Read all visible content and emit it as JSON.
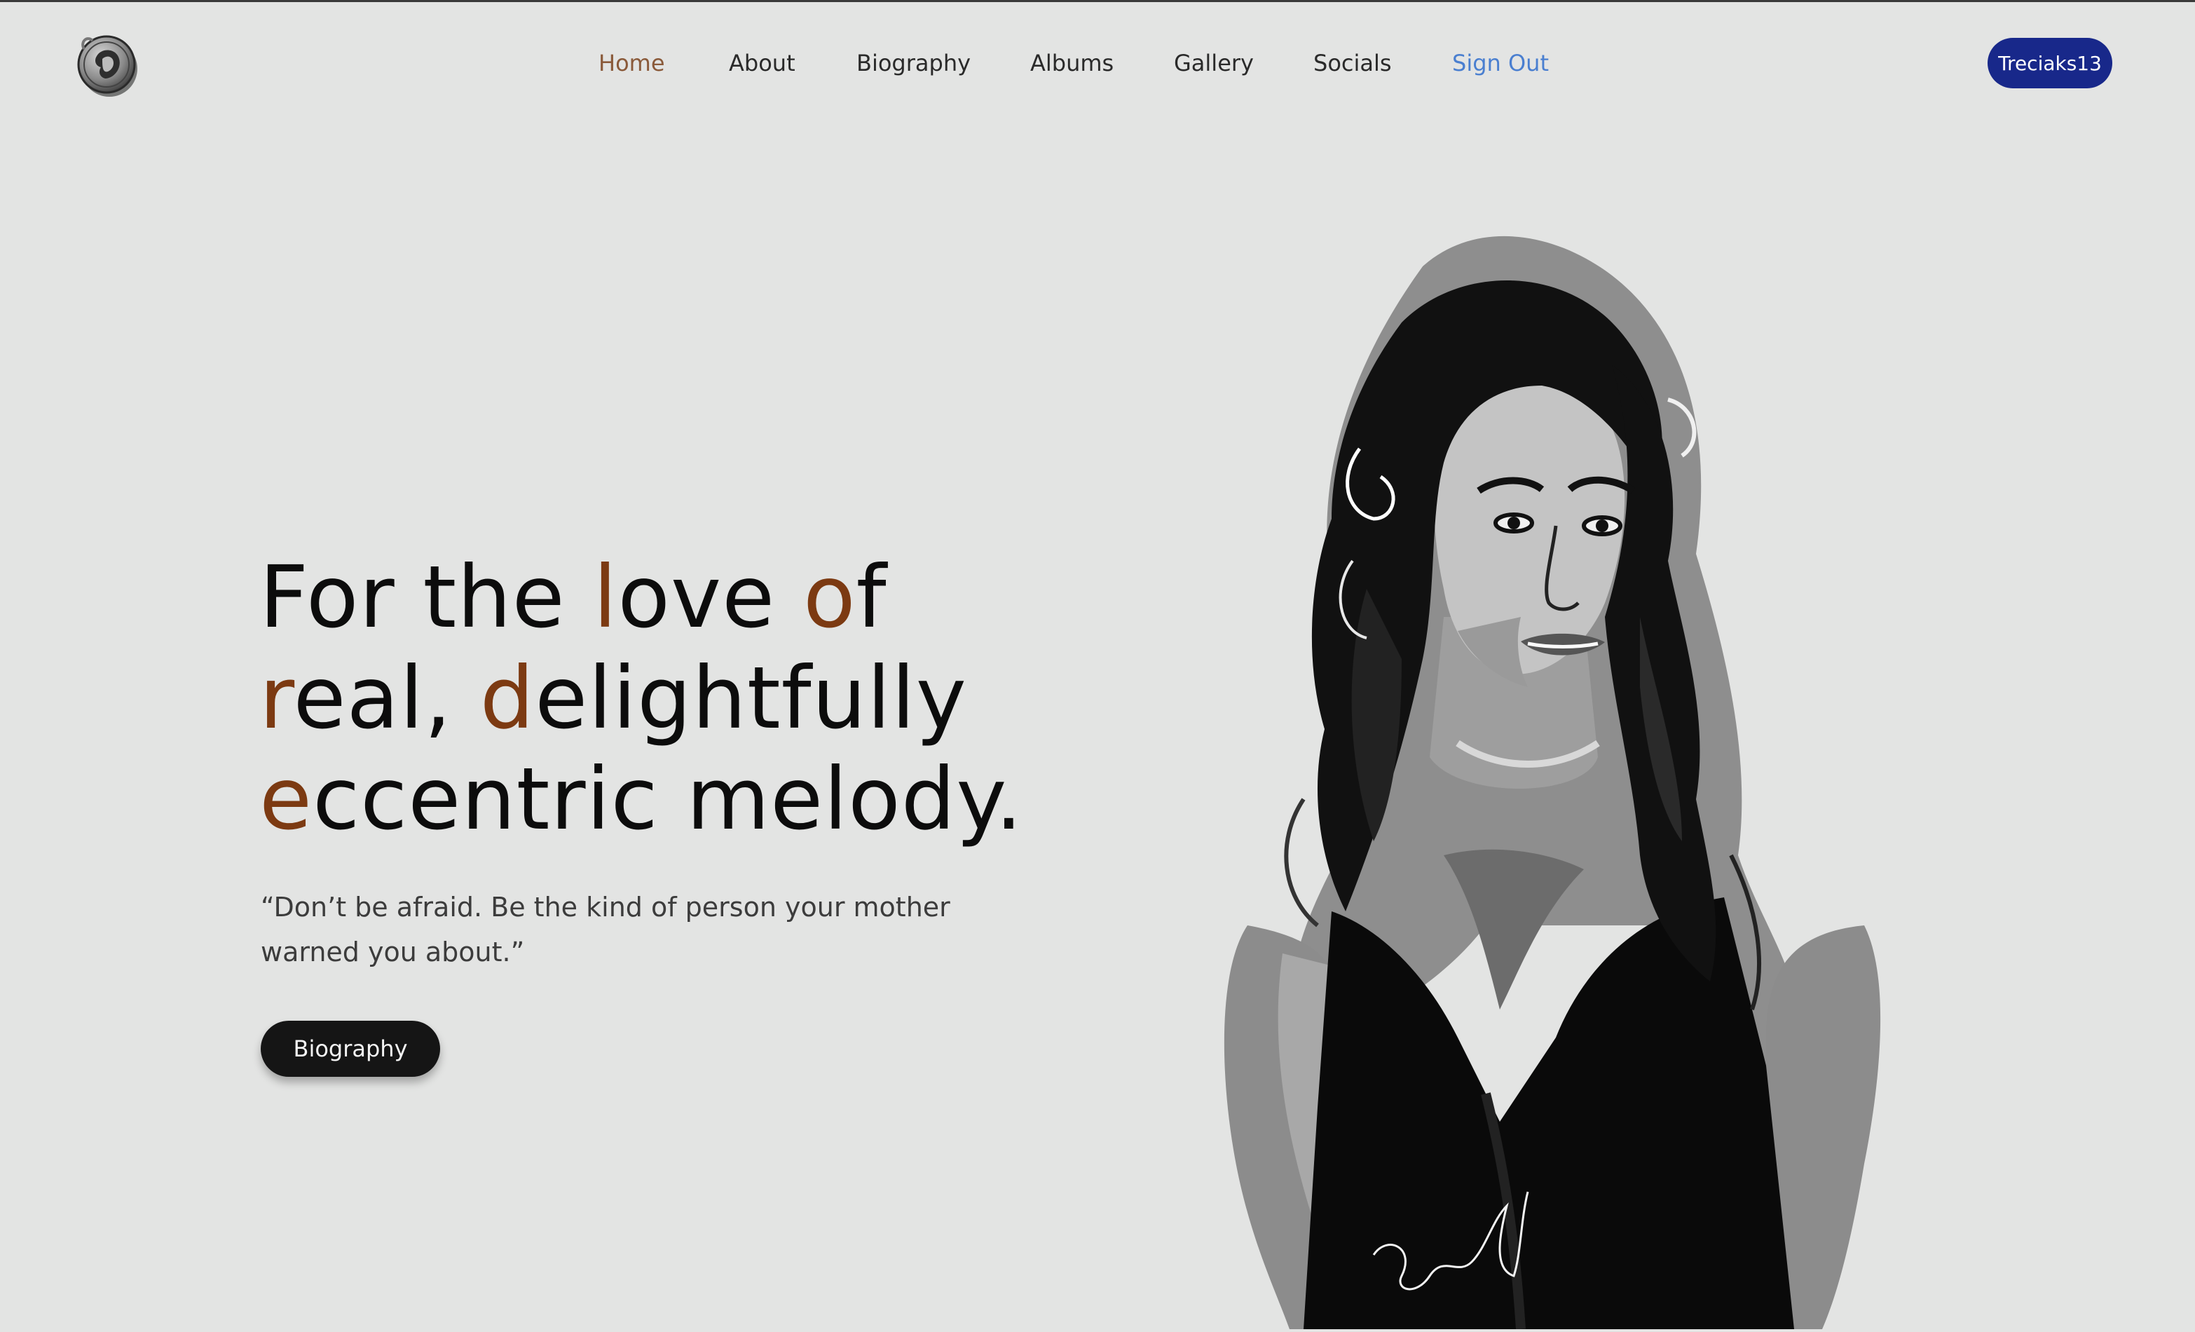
{
  "colors": {
    "background": "#e3e4e3",
    "accent_brown": "#7c3a12",
    "nav_active": "#8a5a3a",
    "sign_out_blue": "#4a7fd0",
    "user_pill": "#18288a",
    "cta_button": "#151515"
  },
  "header": {
    "logo_icon": "coin-portrait-logo",
    "nav": [
      {
        "label": "Home",
        "state": "active"
      },
      {
        "label": "About"
      },
      {
        "label": "Biography"
      },
      {
        "label": "Albums"
      },
      {
        "label": "Gallery"
      },
      {
        "label": "Socials"
      },
      {
        "label": "Sign Out",
        "style": "link-blue"
      }
    ],
    "user_label": "Treciaks13"
  },
  "hero": {
    "headline": {
      "line1": {
        "a": "For the ",
        "b": "l",
        "c": "ove ",
        "d": "o",
        "e": "f"
      },
      "line2": {
        "a": "r",
        "b": "eal, ",
        "c": "d",
        "d": "elightfully"
      },
      "line3": {
        "a": "e",
        "b": "ccentric melody."
      }
    },
    "quote_line1": "“Don’t be afraid. Be the kind of person your mother",
    "quote_line2": "warned you about.”",
    "cta_label": "Biography"
  },
  "illustration": {
    "icon": "woman-curly-hair-portrait",
    "signature": "artist-signature"
  }
}
